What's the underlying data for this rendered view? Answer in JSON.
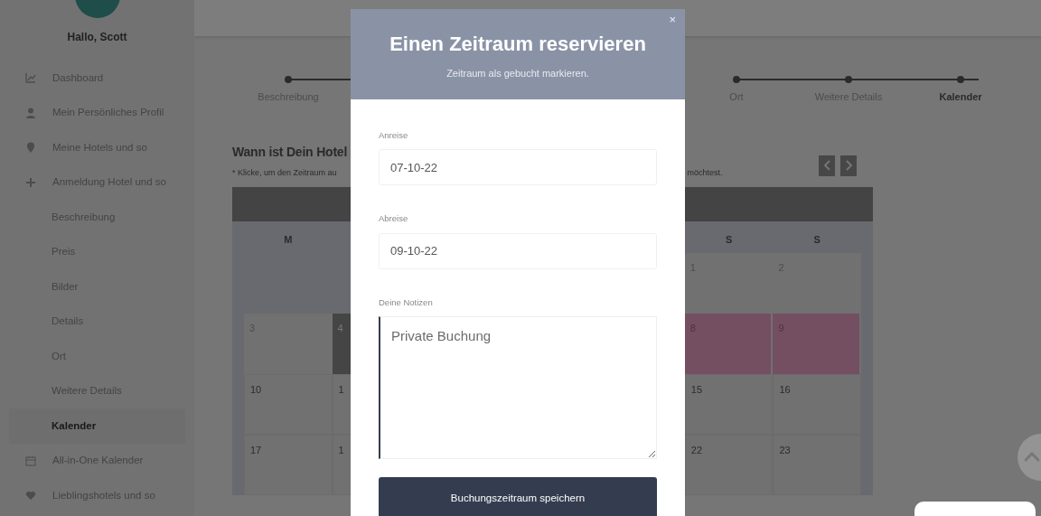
{
  "sidebar": {
    "greeting": "Hallo, Scott",
    "items": [
      {
        "label": "Dashboard",
        "selected": false
      },
      {
        "label": "Mein Persönliches Profil",
        "selected": false
      },
      {
        "label": "Meine Hotels und so",
        "selected": false
      },
      {
        "label": "Anmeldung Hotel und so",
        "selected": false,
        "children": [
          {
            "label": "Beschreibung",
            "selected": false
          },
          {
            "label": "Preis",
            "selected": false
          },
          {
            "label": "Bilder",
            "selected": false
          },
          {
            "label": "Details",
            "selected": false
          },
          {
            "label": "Ort",
            "selected": false
          },
          {
            "label": "Weitere Details",
            "selected": false
          },
          {
            "label": "Kalender",
            "selected": true
          }
        ]
      },
      {
        "label": "All-in-One Kalender",
        "selected": false
      },
      {
        "label": "Lieblingshotels und so",
        "selected": false
      }
    ]
  },
  "stepper": [
    {
      "label": "Beschreibung",
      "selected": false
    },
    {
      "label": "Ort",
      "selected": false
    },
    {
      "label": "Weitere Details",
      "selected": false
    },
    {
      "label": "Kalender",
      "selected": true
    }
  ],
  "calendar_section": {
    "heading": "Wann ist Dein Hotel",
    "note_start": "* Klicke, um den Zeitraum au",
    "note_end": "möchtest.",
    "nav": [
      {
        "kind": "prev"
      },
      {
        "kind": "next"
      }
    ],
    "weekdays_left": [
      "M"
    ],
    "weekdays_right": [
      "S",
      "S"
    ],
    "rows": [
      {
        "right": [
          {
            "day": "1",
            "kind": "past"
          },
          {
            "day": "2",
            "kind": "past"
          }
        ]
      },
      {
        "left": [
          {
            "day": "3",
            "kind": "past"
          },
          {
            "day": "4",
            "kind": "today"
          }
        ],
        "right": [
          {
            "day": "8",
            "kind": "booked"
          },
          {
            "day": "9",
            "kind": "booked"
          }
        ]
      },
      {
        "left": [
          {
            "day": "10",
            "kind": "normal"
          },
          {
            "day": "1",
            "kind": "normal"
          }
        ],
        "right": [
          {
            "day": "15",
            "kind": "normal"
          },
          {
            "day": "16",
            "kind": "normal"
          }
        ]
      },
      {
        "left": [
          {
            "day": "17",
            "kind": "normal"
          },
          {
            "day": "1",
            "kind": "normal"
          }
        ],
        "right": [
          {
            "day": "22",
            "kind": "normal"
          },
          {
            "day": "23",
            "kind": "normal"
          }
        ]
      }
    ]
  },
  "modal": {
    "close": "×",
    "title": "Einen Zeitraum reservieren",
    "subtitle": "Zeitraum als gebucht markieren.",
    "fields": [
      {
        "label": "Anreise",
        "value": "07-10-22",
        "kind": "input"
      },
      {
        "label": "Abreise",
        "value": "09-10-22",
        "kind": "input"
      },
      {
        "label": "Deine Notizen",
        "value": "Private Buchung",
        "kind": "textarea"
      }
    ],
    "submit": "Buchungszeitraum speichern"
  }
}
